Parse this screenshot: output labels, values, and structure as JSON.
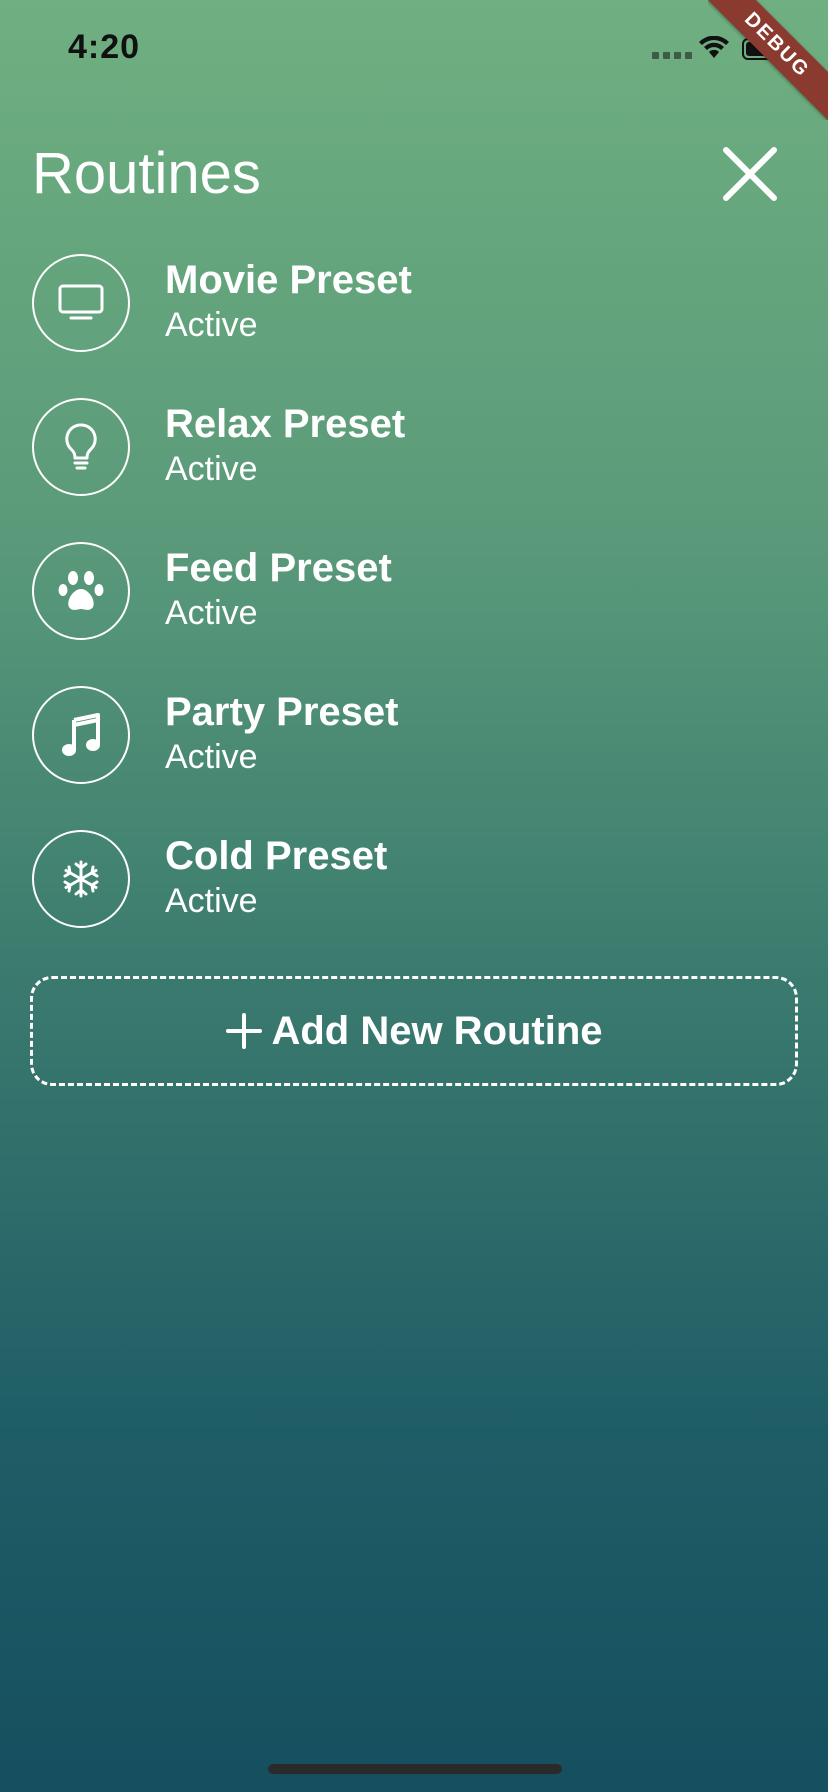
{
  "status_bar": {
    "time": "4:20"
  },
  "debug_banner": "DEBUG",
  "header": {
    "title": "Routines"
  },
  "routines": [
    {
      "name": "Movie Preset",
      "status": "Active",
      "icon": "tv-icon"
    },
    {
      "name": "Relax Preset",
      "status": "Active",
      "icon": "lightbulb-icon"
    },
    {
      "name": "Feed Preset",
      "status": "Active",
      "icon": "paw-icon"
    },
    {
      "name": "Party Preset",
      "status": "Active",
      "icon": "music-note-icon"
    },
    {
      "name": "Cold Preset",
      "status": "Active",
      "icon": "snowflake-icon"
    }
  ],
  "add_button": {
    "label": "Add New Routine",
    "icon": "plus-icon"
  },
  "colors": {
    "gradient_top": "#6faf80",
    "gradient_bottom": "#164f5f",
    "debug_ribbon": "#8b3a2f",
    "text": "#ffffff"
  }
}
